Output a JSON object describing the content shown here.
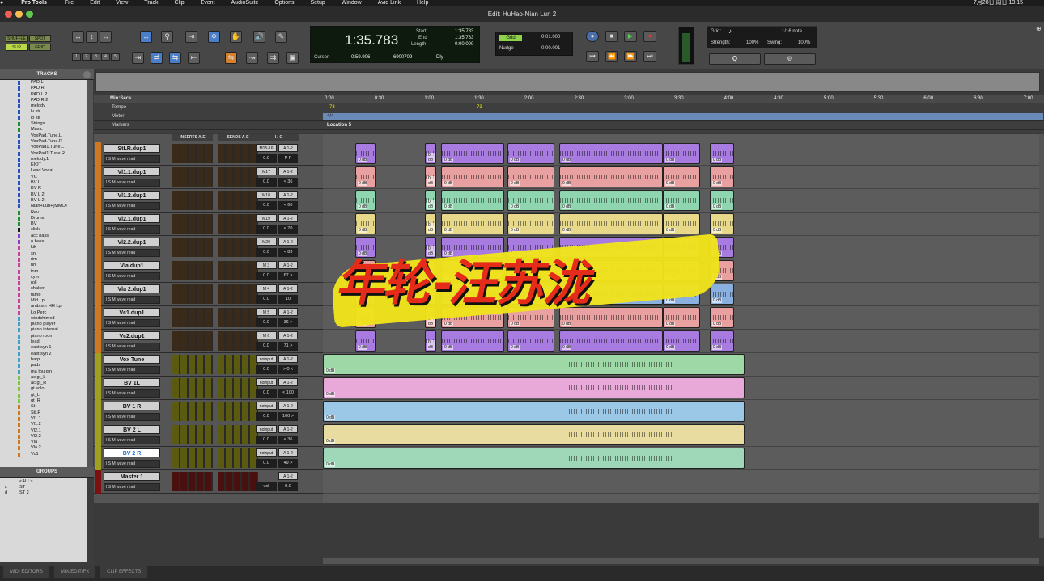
{
  "menubar": {
    "app": "Pro Tools",
    "items": [
      "File",
      "Edit",
      "View",
      "Track",
      "Clip",
      "Event",
      "AudioSuite",
      "Options",
      "Setup",
      "Window",
      "Avid Link",
      "Help"
    ],
    "clock": "7月28日 周日 13:15"
  },
  "window": {
    "title": "Edit: HuHao-Nian Lun 2"
  },
  "toolbar": {
    "modes": [
      "SHUFFLE",
      "SPOT",
      "SLIP",
      "GRID"
    ],
    "zoom_presets": [
      "1",
      "2",
      "3",
      "4",
      "5"
    ],
    "main_counter": "1:35.783",
    "start_label": "Start",
    "start_val": "1:35.783",
    "end_label": "End",
    "end_val": "1:35.783",
    "length_label": "Length",
    "length_val": "0:00.000",
    "cursor_label": "Cursor",
    "cursor_val": "0:59.906",
    "sample_val": "6900709",
    "dly": "Dly",
    "grid_label": "Grid",
    "grid_val": "0:01.000",
    "nudge_label": "Nudge",
    "nudge_val": "0:00.001",
    "grid2_label": "Grid:",
    "grid2_val": "1/16 note",
    "strength_label": "Strength:",
    "strength_val": "100%",
    "swing_label": "Swing:",
    "swing_val": "100%",
    "q_label": "Q"
  },
  "tracklist": {
    "header": "TRACKS",
    "items": [
      "PAD L",
      "PAD R",
      "PAD L.2",
      "PAD R.2",
      "melody",
      "lv str",
      "lo str",
      "Strings",
      "Music",
      "VoxPad.Tune.L",
      "VoxPad.Tune.R",
      "VoxPad1.Tune.L",
      "VoxPad1.Tune.R",
      "melody.1",
      "EIOT",
      "Lead Vocal",
      "VC",
      "BV L",
      "BV R",
      "BV L 2",
      "BV L 2",
      "Nian+Lun+(MMO)",
      "Rev",
      "Drums",
      "BV",
      "click",
      "acc bass",
      "o bass",
      "kik",
      "sn",
      "rim",
      "hh",
      "tom",
      "cym",
      "roll",
      "shaker",
      "tamb",
      "Mid Lp",
      "amb snr HH Lp",
      "Lo Perc",
      "windchimed",
      "piano player",
      "piano internal",
      "piano room",
      "lead",
      "east syn 1",
      "east syn 2",
      "harp",
      "pads",
      "ma tou qin",
      "ac gt_L",
      "ac gt_R",
      "gt solo",
      "gt_L",
      "gt_R",
      "St",
      "StLR",
      "Vl1.1",
      "Vl1.2",
      "Vl2.1",
      "Vl2.2",
      "Vla",
      "Vla 2",
      "Vc1"
    ],
    "colors": [
      "#2a4fbf",
      "#2a4fbf",
      "#2a4fbf",
      "#2a4fbf",
      "#2a4fbf",
      "#2a4fbf",
      "#2a4fbf",
      "#1d8f2e",
      "#1d8f2e",
      "#2a4fbf",
      "#2a4fbf",
      "#2a4fbf",
      "#2a4fbf",
      "#2a4fbf",
      "#2a4fbf",
      "#2a4fbf",
      "#2a4fbf",
      "#2a4fbf",
      "#2a4fbf",
      "#2a4fbf",
      "#2a4fbf",
      "#2a4fbf",
      "#1d8f2e",
      "#1d8f2e",
      "#1d8f2e",
      "#1a1a1a",
      "#8a3fc8",
      "#8a3fc8",
      "#c83fa0",
      "#c83fa0",
      "#c83fa0",
      "#c83fa0",
      "#c83fa0",
      "#c83fa0",
      "#c83fa0",
      "#c83fa0",
      "#c83fa0",
      "#c83fa0",
      "#c83fa0",
      "#c83fa0",
      "#3fa0c8",
      "#3fa0c8",
      "#3fa0c8",
      "#3fa0c8",
      "#3fa0c8",
      "#3fa0c8",
      "#3fa0c8",
      "#3fa0c8",
      "#3fa0c8",
      "#3fa0c8",
      "#7ec83f",
      "#7ec83f",
      "#7ec83f",
      "#7ec83f",
      "#7ec83f",
      "#d07820",
      "#d07820",
      "#d07820",
      "#d07820",
      "#d07820",
      "#d07820",
      "#d07820",
      "#d07820",
      "#d07820"
    ]
  },
  "groups": {
    "header": "GROUPS",
    "items": [
      "<ALL>",
      "ST",
      "ST 2"
    ],
    "letters": [
      "",
      "c",
      "d"
    ]
  },
  "columns": {
    "inserts": "INSERTS A-E",
    "sends": "SENDS A-E",
    "io": "I / O"
  },
  "ruler": {
    "label": "Min:Secs",
    "tempo": "Tempo",
    "meter": "Meter",
    "markers": "Markers",
    "tempo_val": "73",
    "tempo_val2": "73",
    "meter_val": "4/4",
    "marker_val": "Location 5",
    "ticks": [
      "0:00",
      "0:30",
      "1:00",
      "1:30",
      "2:00",
      "2:30",
      "3:00",
      "3:30",
      "4:00",
      "4:30",
      "5:00",
      "5:30",
      "6:00",
      "6:30",
      "7:00"
    ]
  },
  "tracks": [
    {
      "name": "StLR.dup1",
      "io1": "M15-16",
      "io2": "A 1-2",
      "vol": "0.0",
      "pan": "P P",
      "strip": "#d07820",
      "ins": "#3a2a1a",
      "clipcolor": "#a77be0"
    },
    {
      "name": "Vl1.1.dup1",
      "io1": "M17",
      "io2": "A 1-2",
      "vol": "0.0",
      "pan": "< 36",
      "strip": "#d07820",
      "ins": "#3a2a1a",
      "clipcolor": "#e8a0a0"
    },
    {
      "name": "Vl1.2.dup1",
      "io1": "M18",
      "io2": "A 1-2",
      "vol": "0.0",
      "pan": "< 60",
      "strip": "#d07820",
      "ins": "#3a2a1a",
      "clipcolor": "#8fd6b0"
    },
    {
      "name": "Vl2.1.dup1",
      "io1": "M19",
      "io2": "A 1-2",
      "vol": "0.0",
      "pan": "< 70",
      "strip": "#d07820",
      "ins": "#3a2a1a",
      "clipcolor": "#e8d88a"
    },
    {
      "name": "Vl2.2.dup1",
      "io1": "M20",
      "io2": "A 1-2",
      "vol": "0.0",
      "pan": "< 83",
      "strip": "#d07820",
      "ins": "#3a2a1a",
      "clipcolor": "#a77be0"
    },
    {
      "name": "Vla.dup1",
      "io1": "M 3",
      "io2": "A 1-2",
      "vol": "0.0",
      "pan": "67 >",
      "strip": "#d07820",
      "ins": "#3a2a1a",
      "clipcolor": "#e8a0a0"
    },
    {
      "name": "Vla 2.dup1",
      "io1": "M 4",
      "io2": "A 1-2",
      "vol": "0.0",
      "pan": "10",
      "strip": "#d07820",
      "ins": "#3a2a1a",
      "clipcolor": "#8ab0e0"
    },
    {
      "name": "Vc1.dup1",
      "io1": "M 5",
      "io2": "A 1-2",
      "vol": "0.0",
      "pan": "36 >",
      "strip": "#d07820",
      "ins": "#3a2a1a",
      "clipcolor": "#e8a0a0"
    },
    {
      "name": "Vc2.dup1",
      "io1": "M 6",
      "io2": "A 1-2",
      "vol": "0.0",
      "pan": "71 >",
      "strip": "#d07820",
      "ins": "#3a2a1a",
      "clipcolor": "#a77be0"
    },
    {
      "name": "Vox Tune",
      "io1": "noinput",
      "io2": "A 1-2",
      "vol": "0.0",
      "pan": "> 0 <",
      "strip": "#a0a020",
      "ins": "#5a5a10",
      "clipcolor": "#9ed8a6"
    },
    {
      "name": "BV 1L",
      "io1": "noinput",
      "io2": "A 1-2",
      "vol": "0.0",
      "pan": "< 100",
      "strip": "#a0a020",
      "ins": "#5a5a10",
      "clipcolor": "#e8a8d8"
    },
    {
      "name": "BV 1 R",
      "io1": "noinput",
      "io2": "A 1-2",
      "vol": "0.0",
      "pan": "100 >",
      "strip": "#a0a020",
      "ins": "#5a5a10",
      "clipcolor": "#9cc8e8"
    },
    {
      "name": "BV 2 L",
      "io1": "noinput",
      "io2": "A 1-2",
      "vol": "0.0",
      "pan": "< 36",
      "strip": "#a0a020",
      "ins": "#5a5a10",
      "clipcolor": "#e8dca0"
    },
    {
      "name": "BV 2 R",
      "io1": "noinput",
      "io2": "A 1-2",
      "vol": "0.0",
      "pan": "49 >",
      "strip": "#a0a020",
      "ins": "#5a5a10",
      "clipcolor": "#9ed8b8"
    },
    {
      "name": "Master 1",
      "io1": "",
      "io2": "A 1-2",
      "vol": "vol",
      "pan": "0.0",
      "strip": "#7a1010",
      "ins": "#4a1010",
      "clipcolor": ""
    }
  ],
  "track_btns": "I S M  wave  read",
  "clip_label": "0 dB",
  "watermark": "年轮-汪苏泷",
  "bottom_tabs": [
    "MIDI EDITORS",
    "MIX/EDIT/FX",
    "CLIP EFFECTS"
  ]
}
